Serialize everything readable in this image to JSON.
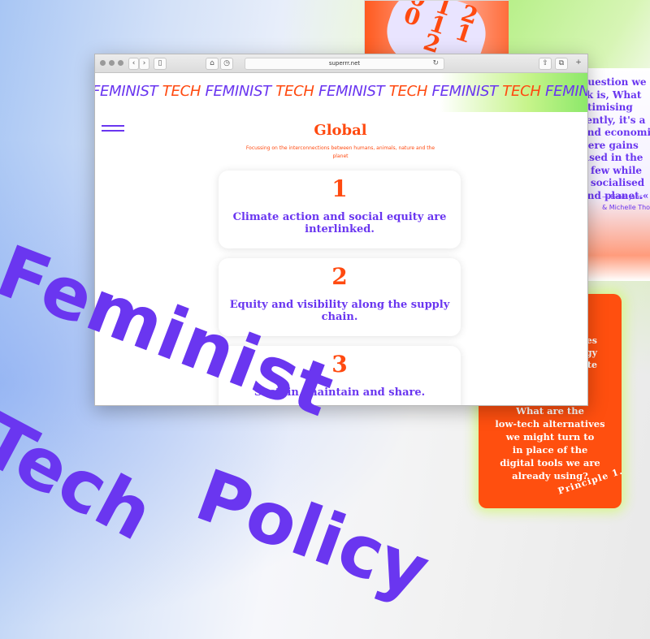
{
  "browser": {
    "url": "superrr.net",
    "marquee_words": [
      "FEMINIST",
      "TECH",
      "FEMINIST",
      "TECH",
      "FEMINIST",
      "TECH",
      "FEMINIST",
      "TECH",
      "FEMINIST"
    ]
  },
  "page": {
    "title": "Global",
    "subtitle": "Focussing on the interconnections between humans, animals, nature and the planet",
    "cards": [
      {
        "number": "1",
        "text": "Climate action and social equity are interlinked."
      },
      {
        "number": "2",
        "text": "Equity and visibility along the supply chain."
      },
      {
        "number": "3",
        "text": "Sustain, maintain and share."
      }
    ]
  },
  "overlay_title": {
    "line1": "Feminist",
    "line2": "Tech",
    "line3": "Policy"
  },
  "poster_top": {
    "digits": "0 1 2 0 1 1 2"
  },
  "quote_poster": {
    "lines": [
      "question we",
      "sk is, What",
      "otimising",
      "rently, it's a",
      "and economic",
      "here gains",
      "tised in the",
      "a few while",
      "e socialised",
      "and planet.«"
    ],
    "author_lines": [
      "— Fieke Jans",
      "& Michelle Tho"
    ]
  },
  "orange_card": {
    "fragment_lines": [
      "les",
      "ology",
      "te"
    ],
    "question_lines": [
      "What are the",
      "low-tech alternatives",
      "we might turn to",
      "in place of the",
      "digital tools we are",
      "already using?"
    ],
    "principle": "Principle 1."
  },
  "colors": {
    "purple": "#6a36f0",
    "orange": "#ff4a10",
    "green": "#b8f08a"
  }
}
